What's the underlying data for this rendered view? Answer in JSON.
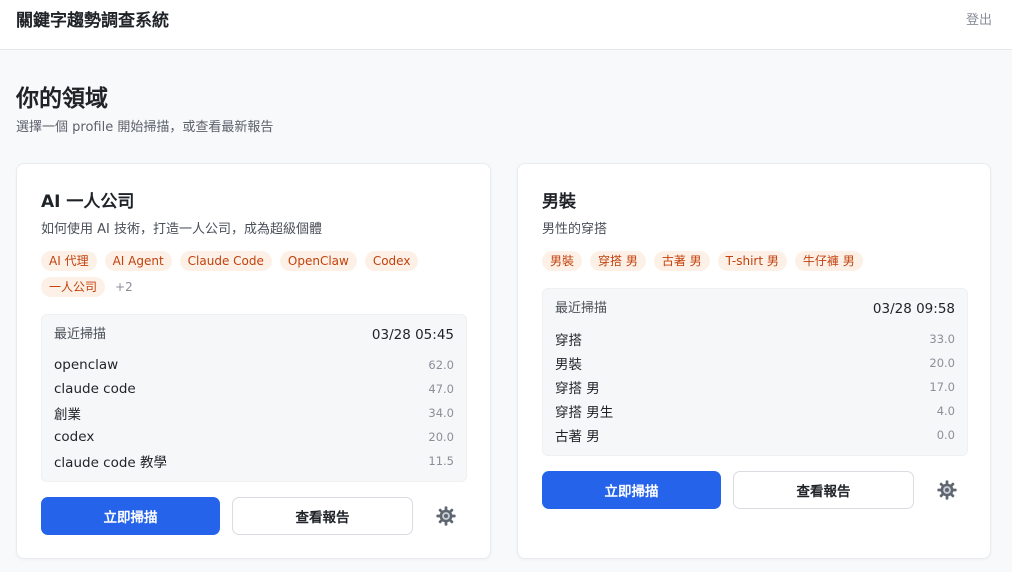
{
  "header": {
    "app_title": "關鍵字趨勢調查系統",
    "logout_label": "登出"
  },
  "page": {
    "title": "你的領域",
    "subtitle": "選擇一個 profile 開始掃描，或查看最新報告"
  },
  "cards": [
    {
      "title": "AI 一人公司",
      "description": "如何使用 AI 技術，打造一人公司，成為超級個體",
      "tags": [
        "AI 代理",
        "AI Agent",
        "Claude Code",
        "OpenClaw",
        "Codex",
        "一人公司"
      ],
      "more_tags": "+2",
      "scan_label": "最近掃描",
      "scan_time": "03/28 05:45",
      "keywords": [
        {
          "name": "openclaw",
          "value": "62.0"
        },
        {
          "name": "claude code",
          "value": "47.0"
        },
        {
          "name": "創業",
          "value": "34.0"
        },
        {
          "name": "codex",
          "value": "20.0"
        },
        {
          "name": "claude code 教學",
          "value": "11.5"
        }
      ],
      "scan_button": "立即掃描",
      "report_button": "查看報告"
    },
    {
      "title": "男裝",
      "description": "男性的穿搭",
      "tags": [
        "男裝",
        "穿搭 男",
        "古著 男",
        "T-shirt 男",
        "牛仔褲 男"
      ],
      "scan_label": "最近掃描",
      "scan_time": "03/28 09:58",
      "keywords": [
        {
          "name": "穿搭",
          "value": "33.0"
        },
        {
          "name": "男裝",
          "value": "20.0"
        },
        {
          "name": "穿搭 男",
          "value": "17.0"
        },
        {
          "name": "穿搭 男生",
          "value": "4.0"
        },
        {
          "name": "古著 男",
          "value": "0.0"
        }
      ],
      "scan_button": "立即掃描",
      "report_button": "查看報告"
    }
  ],
  "colors": {
    "primary": "#2563eb",
    "tag_bg": "#fdf1e7",
    "tag_text": "#c2410c"
  },
  "icons": {
    "settings": "gear-icon"
  }
}
